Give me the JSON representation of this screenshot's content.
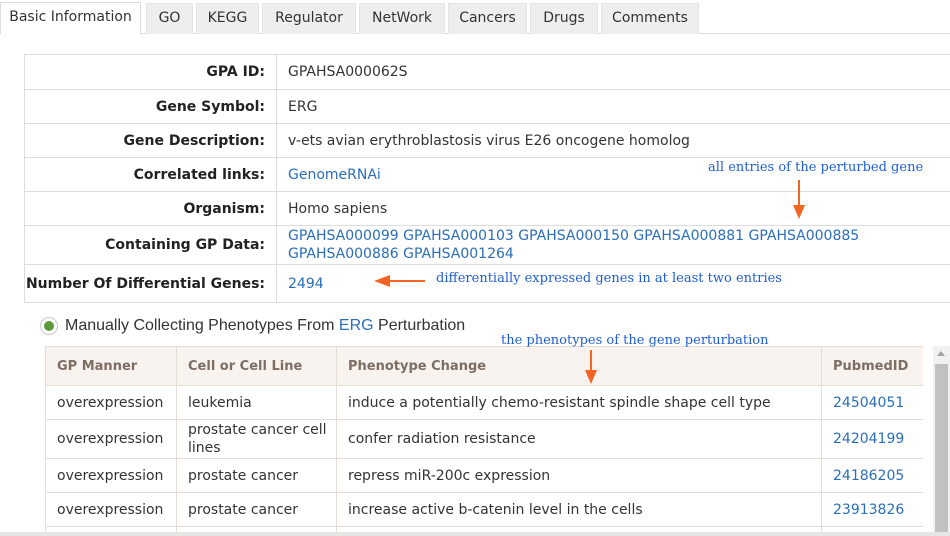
{
  "tabs": [
    {
      "label": "Basic Information",
      "active": true
    },
    {
      "label": "GO",
      "active": false
    },
    {
      "label": "KEGG",
      "active": false
    },
    {
      "label": "Regulator",
      "active": false
    },
    {
      "label": "NetWork",
      "active": false
    },
    {
      "label": "Cancers",
      "active": false
    },
    {
      "label": "Drugs",
      "active": false
    },
    {
      "label": "Comments",
      "active": false
    }
  ],
  "info": {
    "gpa_id": {
      "label": "GPA ID:",
      "value": "GPAHSA000062S"
    },
    "gene_symbol": {
      "label": "Gene Symbol:",
      "value": "ERG"
    },
    "gene_description": {
      "label": "Gene Description:",
      "value": "v-ets avian erythroblastosis virus E26 oncogene homolog"
    },
    "correlated_links": {
      "label": "Correlated links:",
      "value": "GenomeRNAi"
    },
    "organism": {
      "label": "Organism:",
      "value": "Homo sapiens"
    },
    "containing_gp": {
      "label": "Containing GP Data:",
      "values": [
        "GPAHSA000099",
        "GPAHSA000103",
        "GPAHSA000150",
        "GPAHSA000881",
        "GPAHSA000885",
        "GPAHSA000886",
        "GPAHSA001264"
      ]
    },
    "num_diff": {
      "label": "Number Of Differential Genes:",
      "value": "2494"
    }
  },
  "section": {
    "prefix": "Manually Collecting Phenotypes From ",
    "gene": "ERG",
    "suffix": " Perturbation"
  },
  "phenotype_table": {
    "headers": [
      "GP Manner",
      "Cell or Cell Line",
      "Phenotype Change",
      "PubmedID"
    ],
    "rows": [
      {
        "manner": "overexpression",
        "cell": "leukemia",
        "change": "induce a potentially chemo-resistant spindle shape cell type",
        "pubmed": "24504051"
      },
      {
        "manner": "overexpression",
        "cell": "prostate cancer cell lines",
        "change": "confer radiation resistance",
        "pubmed": "24204199"
      },
      {
        "manner": "overexpression",
        "cell": "prostate cancer",
        "change": "repress miR-200c expression",
        "pubmed": "24186205"
      },
      {
        "manner": "overexpression",
        "cell": "prostate cancer",
        "change": "increase active b-catenin level in the cells",
        "pubmed": "23913826"
      }
    ]
  },
  "annotations": {
    "entries": "all entries of the perturbed gene",
    "differential": "differentially expressed genes in at least two entries",
    "phenotypes": "the phenotypes of the gene perturbation",
    "color": "#1f5ed6",
    "arrow_color": "#f26522"
  }
}
